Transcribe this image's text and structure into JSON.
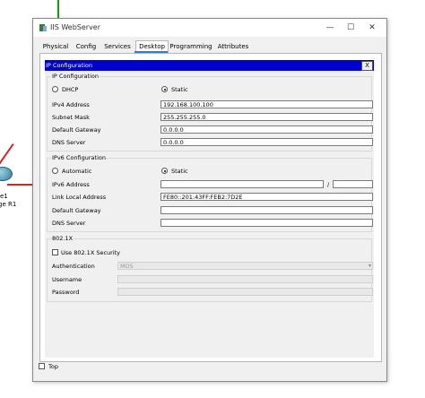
{
  "background": {
    "router_label_line1": "e1",
    "router_label_line2": "ge R1"
  },
  "window": {
    "title": "IIS WebServer",
    "controls": {
      "minimize": "—",
      "maximize": "☐",
      "close": "✕"
    }
  },
  "tabs": [
    {
      "label": "Physical",
      "active": false
    },
    {
      "label": "Config",
      "active": false
    },
    {
      "label": "Services",
      "active": false
    },
    {
      "label": "Desktop",
      "active": true
    },
    {
      "label": "Programming",
      "active": false
    },
    {
      "label": "Attributes",
      "active": false
    }
  ],
  "ip_config": {
    "bar_title": "IP Configuration",
    "close_label": "X",
    "ipv4": {
      "group_title": "IP Configuration",
      "dhcp_label": "DHCP",
      "static_label": "Static",
      "mode": "Static",
      "ipv4_address_label": "IPv4 Address",
      "ipv4_address": "192.168.100.100",
      "subnet_mask_label": "Subnet Mask",
      "subnet_mask": "255.255.255.0",
      "default_gateway_label": "Default Gateway",
      "default_gateway": "0.0.0.0",
      "dns_server_label": "DNS Server",
      "dns_server": "0.0.0.0"
    },
    "ipv6": {
      "group_title": "IPv6 Configuration",
      "automatic_label": "Automatic",
      "static_label": "Static",
      "mode": "Static",
      "ipv6_address_label": "IPv6 Address",
      "ipv6_address": "",
      "prefix_separator": "/",
      "prefix_length": "",
      "link_local_label": "Link Local Address",
      "link_local_address": "FE80::201:43FF:FEB2:7D2E",
      "default_gateway_label": "Default Gateway",
      "default_gateway": "",
      "dns_server_label": "DNS Server",
      "dns_server": ""
    },
    "dot1x": {
      "group_title": "802.1X",
      "use_security_label": "Use 802.1X Security",
      "authentication_label": "Authentication",
      "authentication_value": "MD5",
      "username_label": "Username",
      "username": "",
      "password_label": "Password",
      "password": ""
    }
  },
  "footer": {
    "top_label": "Top"
  }
}
